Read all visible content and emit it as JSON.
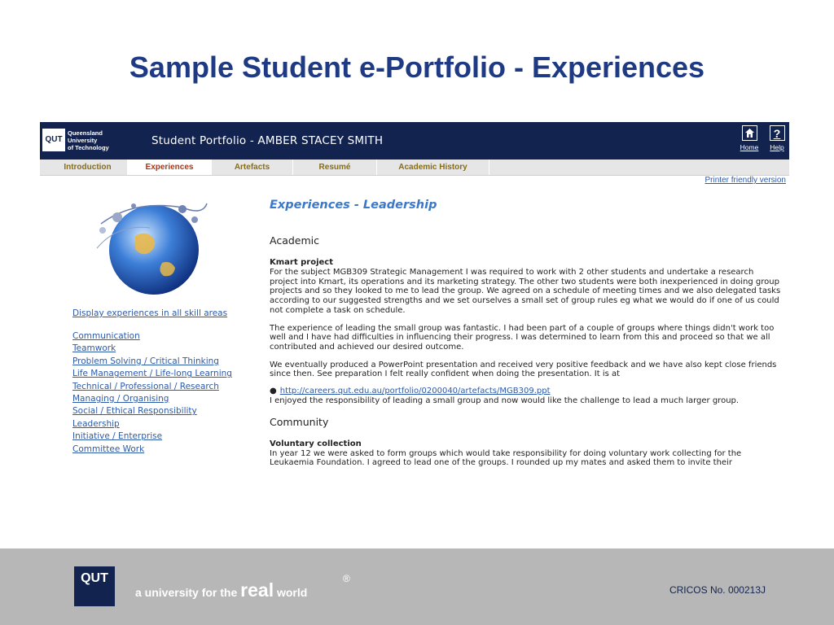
{
  "slide": {
    "title": "Sample Student e-Portfolio - Experiences"
  },
  "header": {
    "logo_text": "QUT",
    "university_name": [
      "Queensland",
      "University",
      "of Technology"
    ],
    "portfolio_title": "Student Portfolio - AMBER STACEY SMITH",
    "home_label": "Home",
    "help_label": "Help",
    "help_symbol": "?"
  },
  "tabs": [
    "Introduction",
    "Experiences",
    "Artefacts",
    "Resumé",
    "Academic History"
  ],
  "printer_link": "Printer friendly version",
  "sidebar": {
    "all_link": "Display experiences in all skill areas",
    "skills": [
      "Communication",
      "Teamwork",
      "Problem Solving / Critical Thinking",
      "Life Management / Life-long Learning",
      "Technical / Professional / Research",
      "Managing / Organising",
      "Social / Ethical Responsibility",
      "Leadership",
      "Initiative / Enterprise",
      "Committee Work"
    ]
  },
  "content": {
    "heading": "Experiences - Leadership",
    "academic_heading": "Academic",
    "kmart_title": "Kmart project",
    "kmart_p1": "For the subject MGB309 Strategic Management I was required to work with 2 other students and undertake a research project into Kmart, its operations and its marketing strategy. The other two students were both inexperienced in doing group projects and so they looked to me to lead the group. We agreed on a schedule of meeting times and we also delegated tasks according to our suggested strengths and we set ourselves a small set of group rules eg what we would do if one of us could not complete a task on schedule.",
    "kmart_p2": "The experience of leading the small group was fantastic. I had been part of a couple of groups where things didn't work too well and I have had difficulties in influencing their progress. I was determined to learn from this and proceed so that we all contributed and achieved our desired outcome.",
    "kmart_p3": "We eventually produced a PowerPoint presentation and received very positive feedback and we have also kept close friends since then. See preparation I felt really confident when doing the presentation. It is at",
    "kmart_link": "http://careers.qut.edu.au/portfolio/0200040/artefacts/MGB309.ppt",
    "kmart_p4": "I enjoyed the responsibility of leading a small group and now would like the challenge to lead a much larger group.",
    "community_heading": "Community",
    "voluntary_title": "Voluntary collection",
    "voluntary_p1": "In year 12 we were asked to form groups which would take responsibility for doing voluntary work collecting for the Leukaemia Foundation. I agreed to lead one of the groups. I rounded up my mates and asked them to invite their"
  },
  "footer": {
    "logo_text": "QUT",
    "tagline_a": "a university for the",
    "tagline_real": "real",
    "tagline_world": "world",
    "registered": "®",
    "cricos": "CRICOS No. 000213J"
  },
  "colors": {
    "title_blue": "#1f3a84",
    "header_navy": "#12234f",
    "link_blue": "#2d5aa8",
    "tab_gold": "#8a6d10",
    "tab_active": "#b3340f",
    "footer_gray": "#b7b7b7"
  }
}
